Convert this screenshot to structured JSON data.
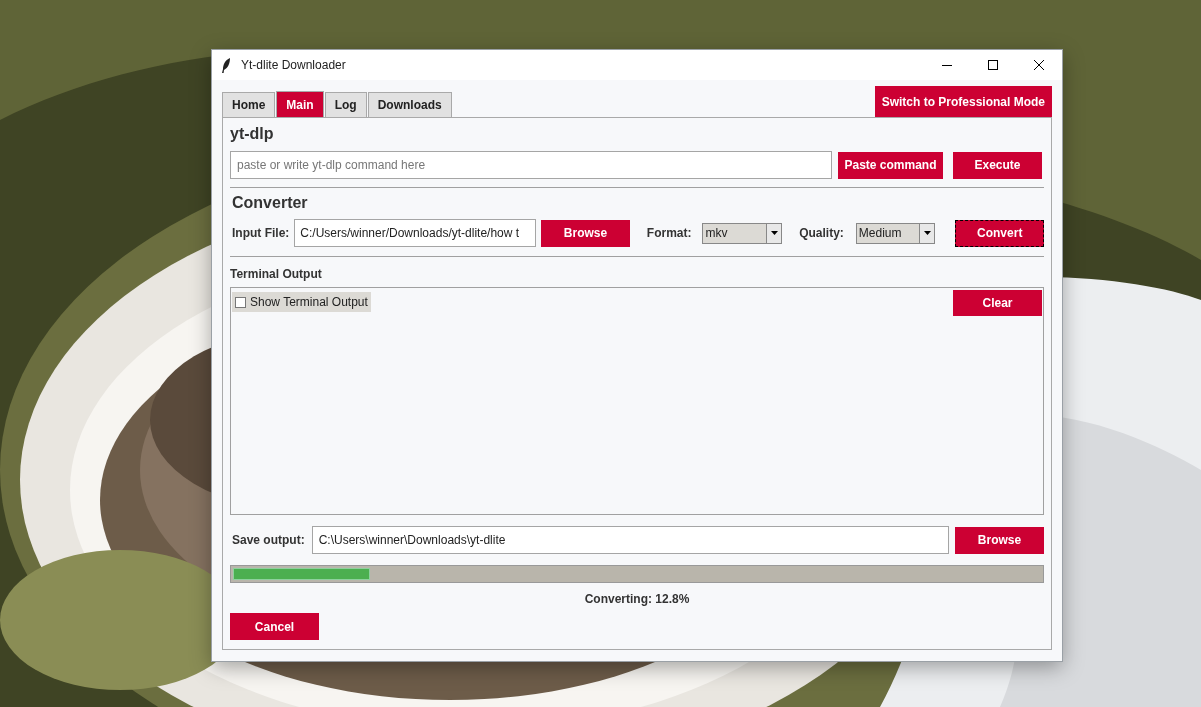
{
  "window": {
    "title": "Yt-dlite Downloader"
  },
  "tabs": [
    {
      "label": "Home",
      "selected": false
    },
    {
      "label": "Main",
      "selected": true
    },
    {
      "label": "Log",
      "selected": false
    },
    {
      "label": "Downloads",
      "selected": false
    }
  ],
  "mode_button": "Switch to Professional Mode",
  "ytdlp": {
    "heading": "yt-dlp",
    "command": {
      "placeholder": "paste or write yt-dlp command here"
    },
    "paste_button": "Paste command",
    "execute_button": "Execute"
  },
  "converter": {
    "heading": "Converter",
    "input_label": "Input File:",
    "input_value": "C:/Users/winner/Downloads/yt-dlite/how t",
    "browse_button": "Browse",
    "format_label": "Format:",
    "format": "mkv",
    "quality_label": "Quality:",
    "quality": "Medium",
    "convert_button": {
      "label": "Convert",
      "focused": true
    }
  },
  "terminal": {
    "heading": "Terminal Output",
    "show_output": {
      "label": "Show Terminal Output",
      "checked": false
    },
    "clear_button": "Clear"
  },
  "save": {
    "label": "Save output:",
    "value": "C:\\Users\\winner\\Downloads\\yt-dlite",
    "browse_button": "Browse"
  },
  "progress": {
    "level": 0.17,
    "status": "Converting: 12.8%"
  },
  "cancel_button": "Cancel"
}
